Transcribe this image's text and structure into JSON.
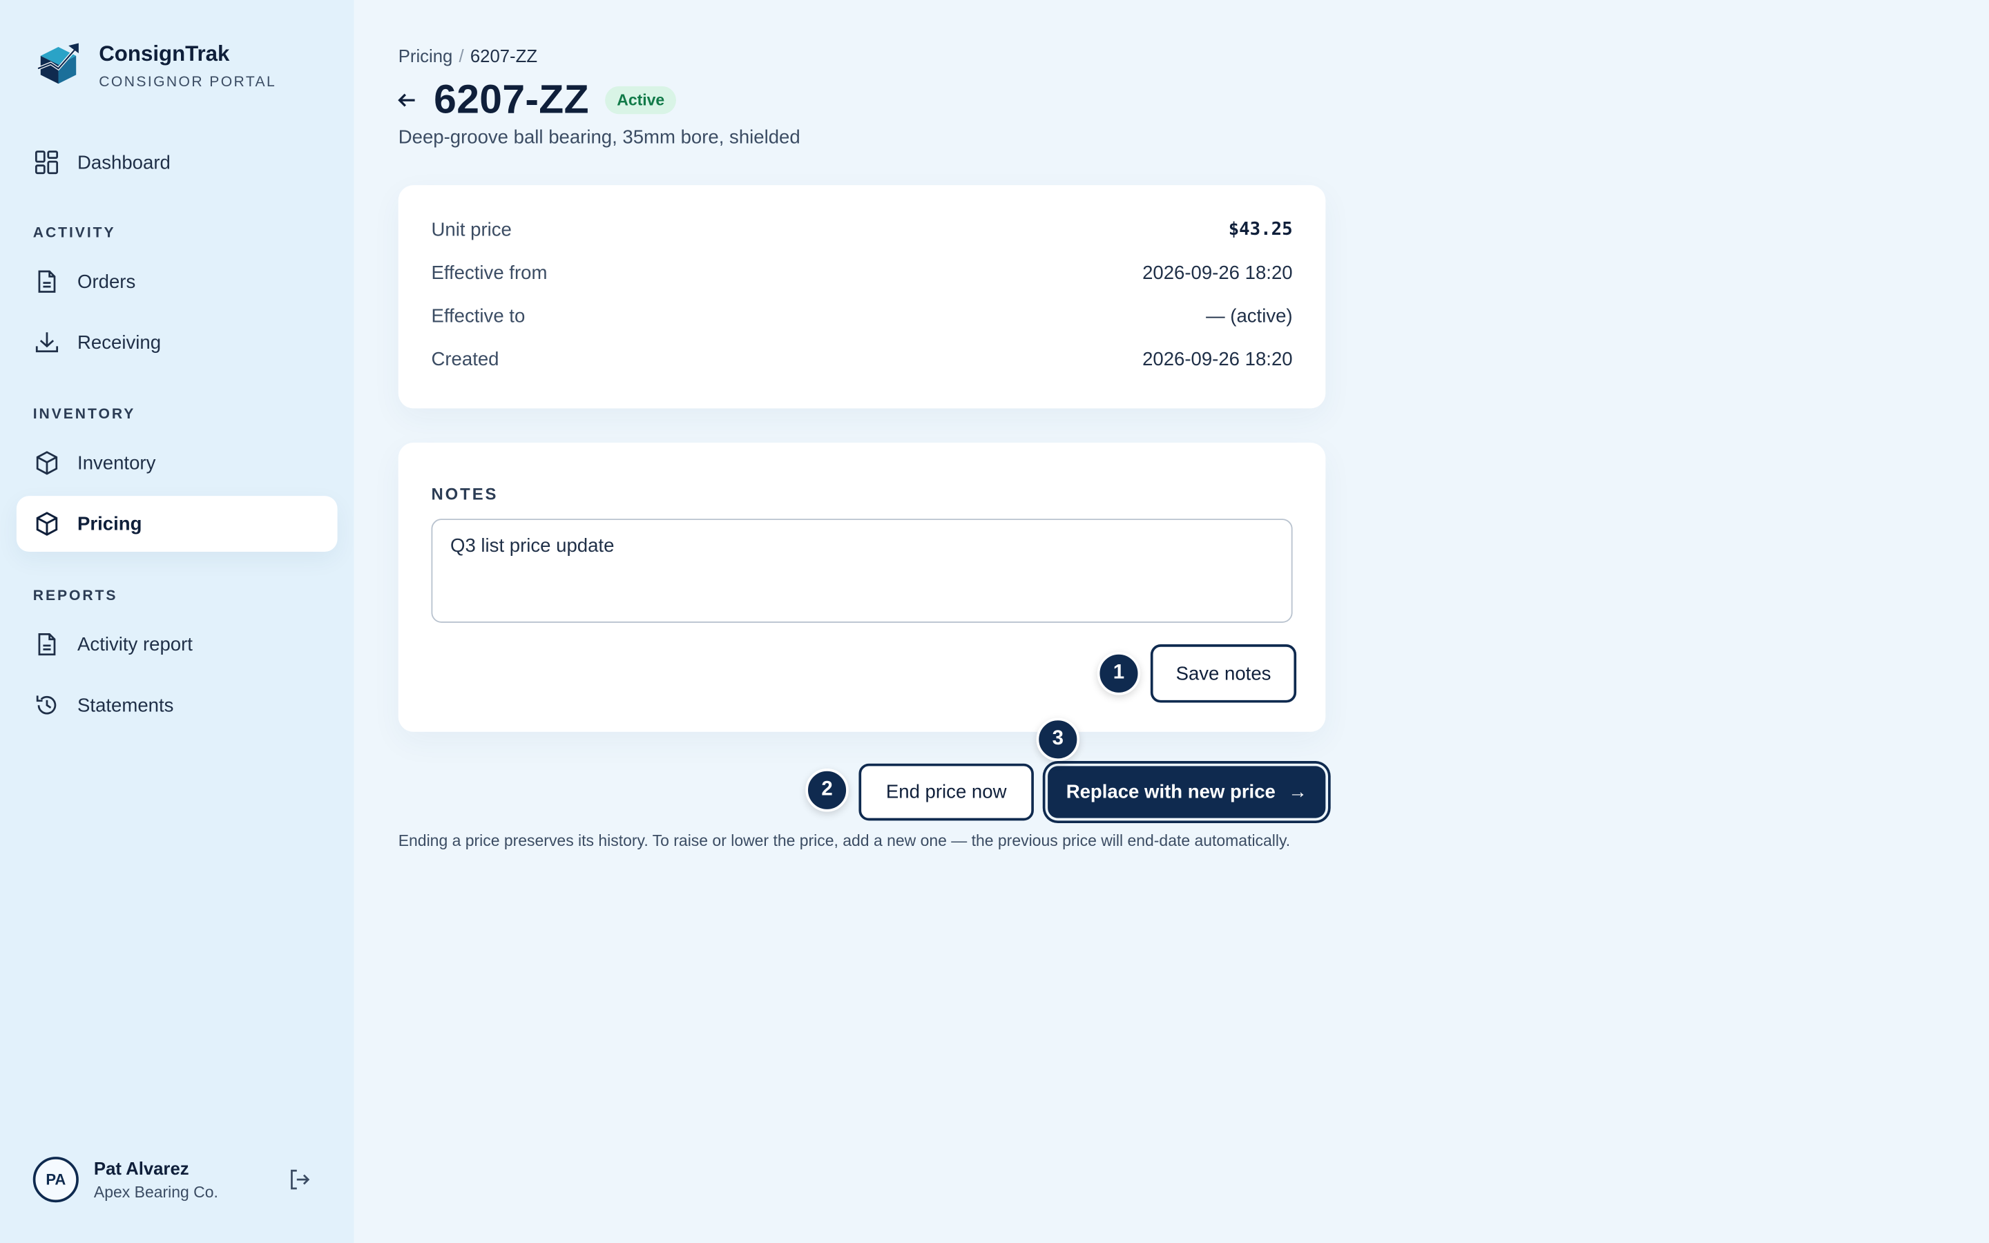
{
  "brand": {
    "name": "ConsignTrak",
    "subtitle": "CONSIGNOR PORTAL"
  },
  "nav": {
    "dashboard": "Dashboard",
    "sections": {
      "activity": "ACTIVITY",
      "inventory": "INVENTORY",
      "reports": "REPORTS"
    },
    "orders": "Orders",
    "receiving": "Receiving",
    "inventory": "Inventory",
    "pricing": "Pricing",
    "activity_report": "Activity report",
    "statements": "Statements",
    "active_item": "Pricing"
  },
  "user": {
    "initials": "PA",
    "name": "Pat Alvarez",
    "org": "Apex Bearing Co."
  },
  "breadcrumb": {
    "parent": "Pricing",
    "separator": "/",
    "current": "6207-ZZ"
  },
  "header": {
    "title": "6207-ZZ",
    "status": "Active",
    "description": "Deep-groove ball bearing, 35mm bore, shielded"
  },
  "details": [
    {
      "label": "Unit price",
      "value": "$43.25"
    },
    {
      "label": "Effective from",
      "value": "2026-09-26 18:20"
    },
    {
      "label": "Effective to",
      "value": "— (active)"
    },
    {
      "label": "Created",
      "value": "2026-09-26 18:20"
    }
  ],
  "notes": {
    "label": "NOTES",
    "value": "Q3 list price update",
    "save_label": "Save notes"
  },
  "actions": {
    "end_label": "End price now",
    "replace_label": "Replace with new price",
    "replace_arrow": "→"
  },
  "markers": [
    "1",
    "2",
    "3"
  ],
  "footnote": "Ending a price preserves its history. To raise or lower the price, add a new one — the previous price will end-date automatically.",
  "colors": {
    "accent": "#0f2a4f",
    "sidebar_bg": "#e2f1fb",
    "page_bg": "#eef6fc",
    "badge_bg": "#d9f4e6",
    "badge_text": "#117a48"
  }
}
